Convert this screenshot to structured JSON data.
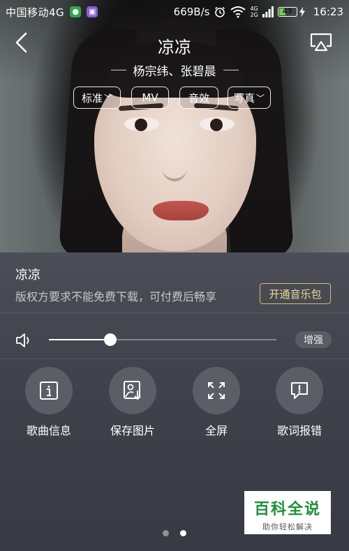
{
  "status_bar": {
    "carrier": "中国移动4G",
    "net_speed": "669B/s",
    "net_type": "4G",
    "net_type2": "2G",
    "battery": "43",
    "time": "16:23"
  },
  "header": {
    "title": "凉凉",
    "artist": "杨宗纬、张碧晨",
    "chips": [
      {
        "label": "标准",
        "dropdown": true
      },
      {
        "label": "MV",
        "dropdown": false
      },
      {
        "label": "音效",
        "dropdown": false
      },
      {
        "label": "写真",
        "dropdown": true
      }
    ]
  },
  "info": {
    "song_name": "凉凉",
    "copyright_notice": "版权方要求不能免费下载，可付费后畅享",
    "vip_button": "开通音乐包"
  },
  "volume": {
    "level": 0.27,
    "boost_label": "增强"
  },
  "actions": [
    {
      "label": "歌曲信息",
      "icon": "info-icon"
    },
    {
      "label": "保存图片",
      "icon": "save-image-icon"
    },
    {
      "label": "全屏",
      "icon": "fullscreen-icon"
    },
    {
      "label": "歌词报错",
      "icon": "report-lyrics-icon"
    }
  ],
  "pager": {
    "count": 2,
    "active": 1
  },
  "watermark": {
    "main": "百科全说",
    "sub": "助你轻松解决"
  },
  "colors": {
    "accent_gold": "#d8b86a",
    "panel_bg": "#40434c",
    "watermark_green": "#1e8f3a"
  }
}
